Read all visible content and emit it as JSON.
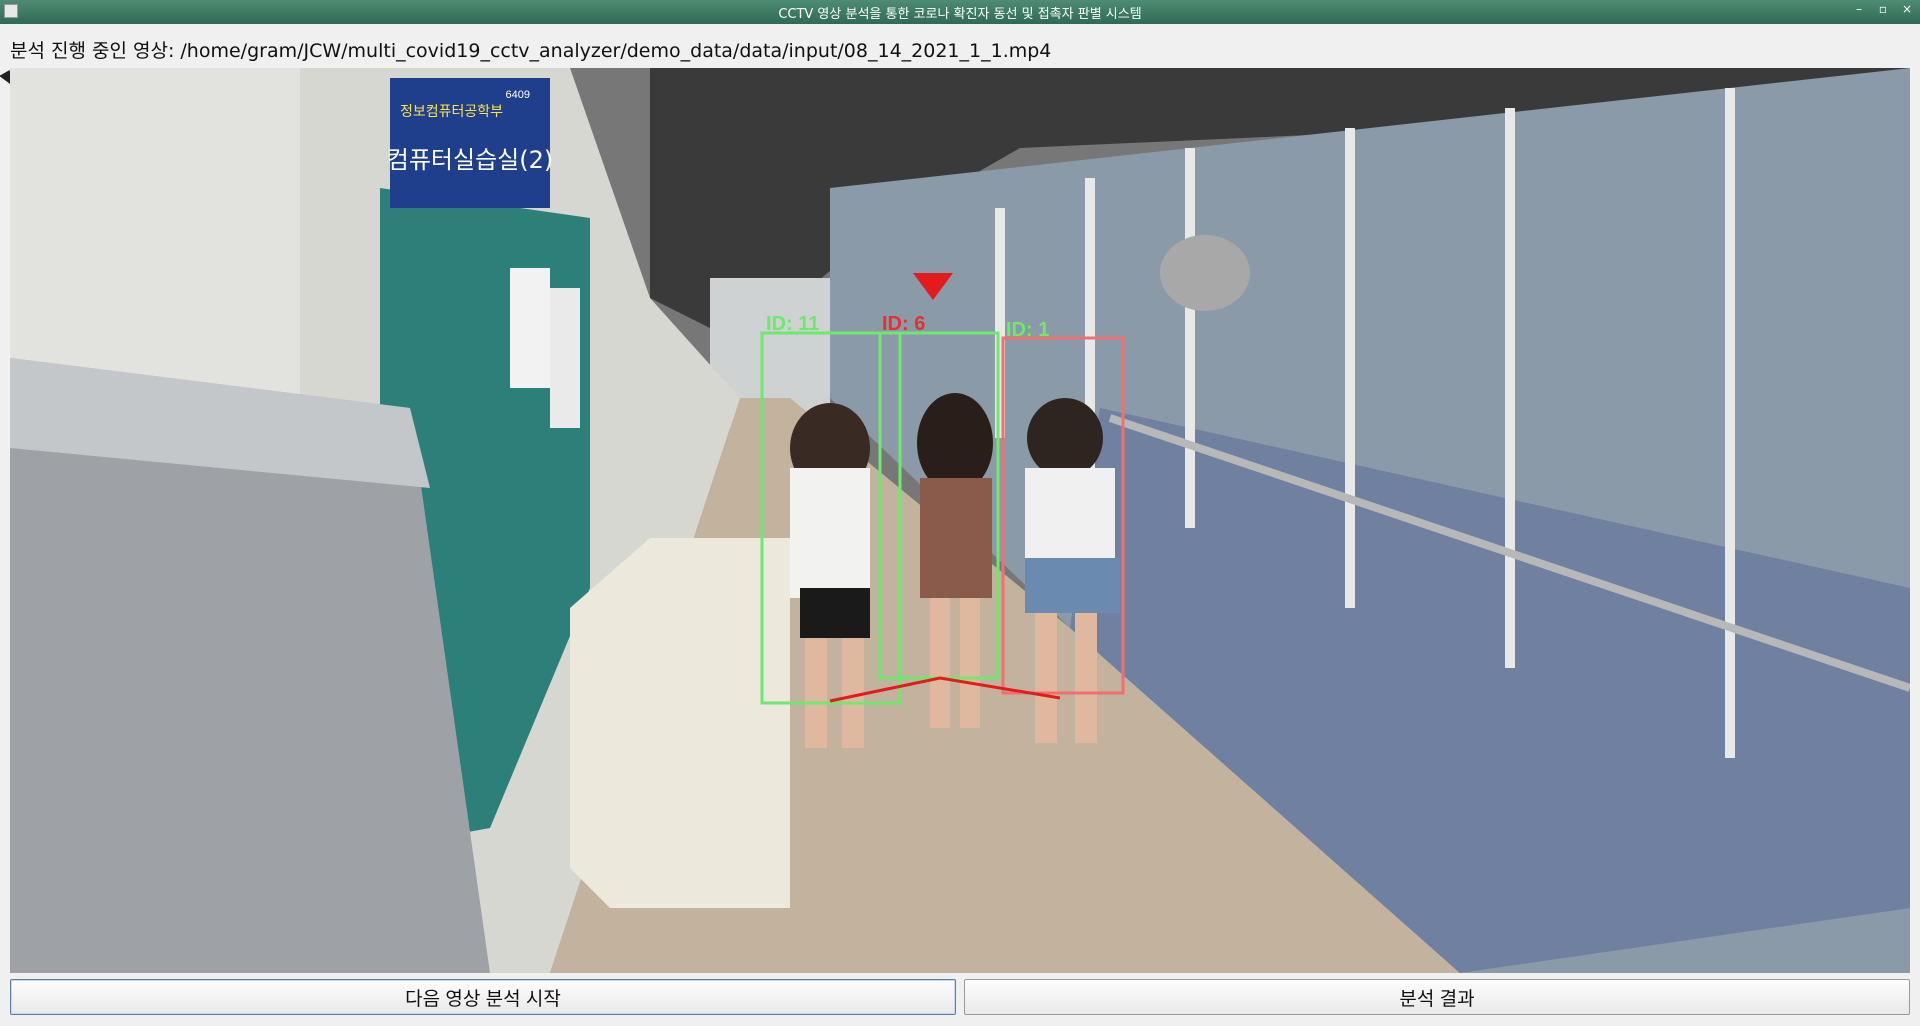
{
  "window": {
    "title": "CCTV 영상 분석을 통한 코로나 확진자 동선 및 접촉자 판별 시스템",
    "controls": {
      "minimize": "–",
      "maximize": "▫",
      "close": "×"
    }
  },
  "analysis": {
    "label": "분석 진행 중인 영상: /home/gram/JCW/multi_covid19_cctv_analyzer/demo_data/data/input/08_14_2021_1_1.mp4"
  },
  "video": {
    "sign_room": "컴퓨터실습실(2)",
    "sign_dept": "정보컴퓨터공학부",
    "sign_number": "6409",
    "detections": [
      {
        "id_label": "ID:  11",
        "color": "#6ee86e"
      },
      {
        "id_label": "ID:  6",
        "color": "#e53030"
      },
      {
        "id_label": "ID:  1",
        "color": "#6ee86e"
      }
    ]
  },
  "buttons": {
    "next_label": "다음 영상 분석 시작",
    "result_label": "분석 결과"
  }
}
